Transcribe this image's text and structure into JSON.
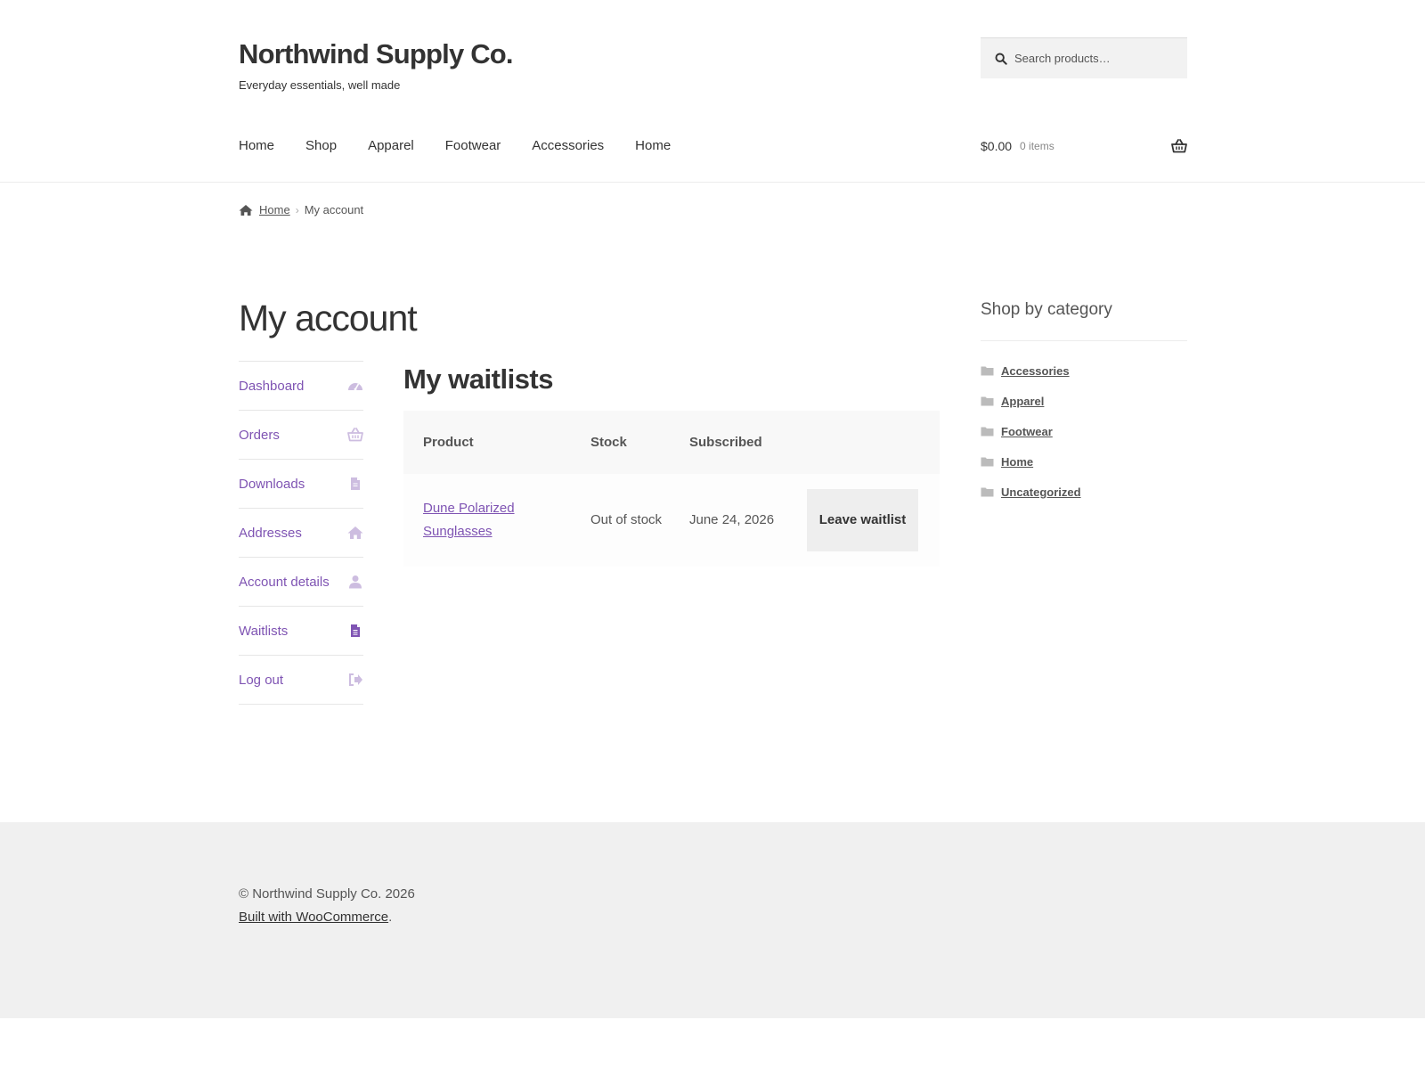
{
  "site": {
    "title": "Northwind Supply Co.",
    "tagline": "Everyday essentials, well made"
  },
  "search": {
    "placeholder": "Search products…"
  },
  "nav": {
    "items": [
      "Home",
      "Shop",
      "Apparel",
      "Footwear",
      "Accessories",
      "Home"
    ]
  },
  "cart": {
    "total": "$0.00",
    "count": "0 items"
  },
  "breadcrumb": {
    "home": "Home",
    "separator": "›",
    "current": "My account"
  },
  "page": {
    "title": "My account"
  },
  "account_nav": {
    "items": [
      {
        "label": "Dashboard",
        "icon": "dashboard-icon"
      },
      {
        "label": "Orders",
        "icon": "basket-icon"
      },
      {
        "label": "Downloads",
        "icon": "file-icon"
      },
      {
        "label": "Addresses",
        "icon": "home-icon"
      },
      {
        "label": "Account details",
        "icon": "user-icon"
      },
      {
        "label": "Waitlists",
        "icon": "document-icon",
        "active": true
      },
      {
        "label": "Log out",
        "icon": "sign-out-icon"
      }
    ]
  },
  "waitlists": {
    "title": "My waitlists",
    "columns": [
      "Product",
      "Stock",
      "Subscribed",
      ""
    ],
    "rows": [
      {
        "product": "Dune Polarized Sunglasses",
        "stock": "Out of stock",
        "subscribed": "June 24, 2026",
        "action": "Leave waitlist"
      }
    ]
  },
  "sidebar": {
    "title": "Shop by category",
    "categories": [
      "Accessories",
      "Apparel",
      "Footwear",
      "Home",
      "Uncategorized"
    ]
  },
  "footer": {
    "copyright": "© Northwind Supply Co. 2026",
    "built_link": "Built with WooCommerce",
    "built_suffix": "."
  },
  "colors": {
    "accent": "#7f54b3",
    "accent_muted": "#cdbde0",
    "footer_bg": "#f0f0f0",
    "text": "#333333"
  }
}
